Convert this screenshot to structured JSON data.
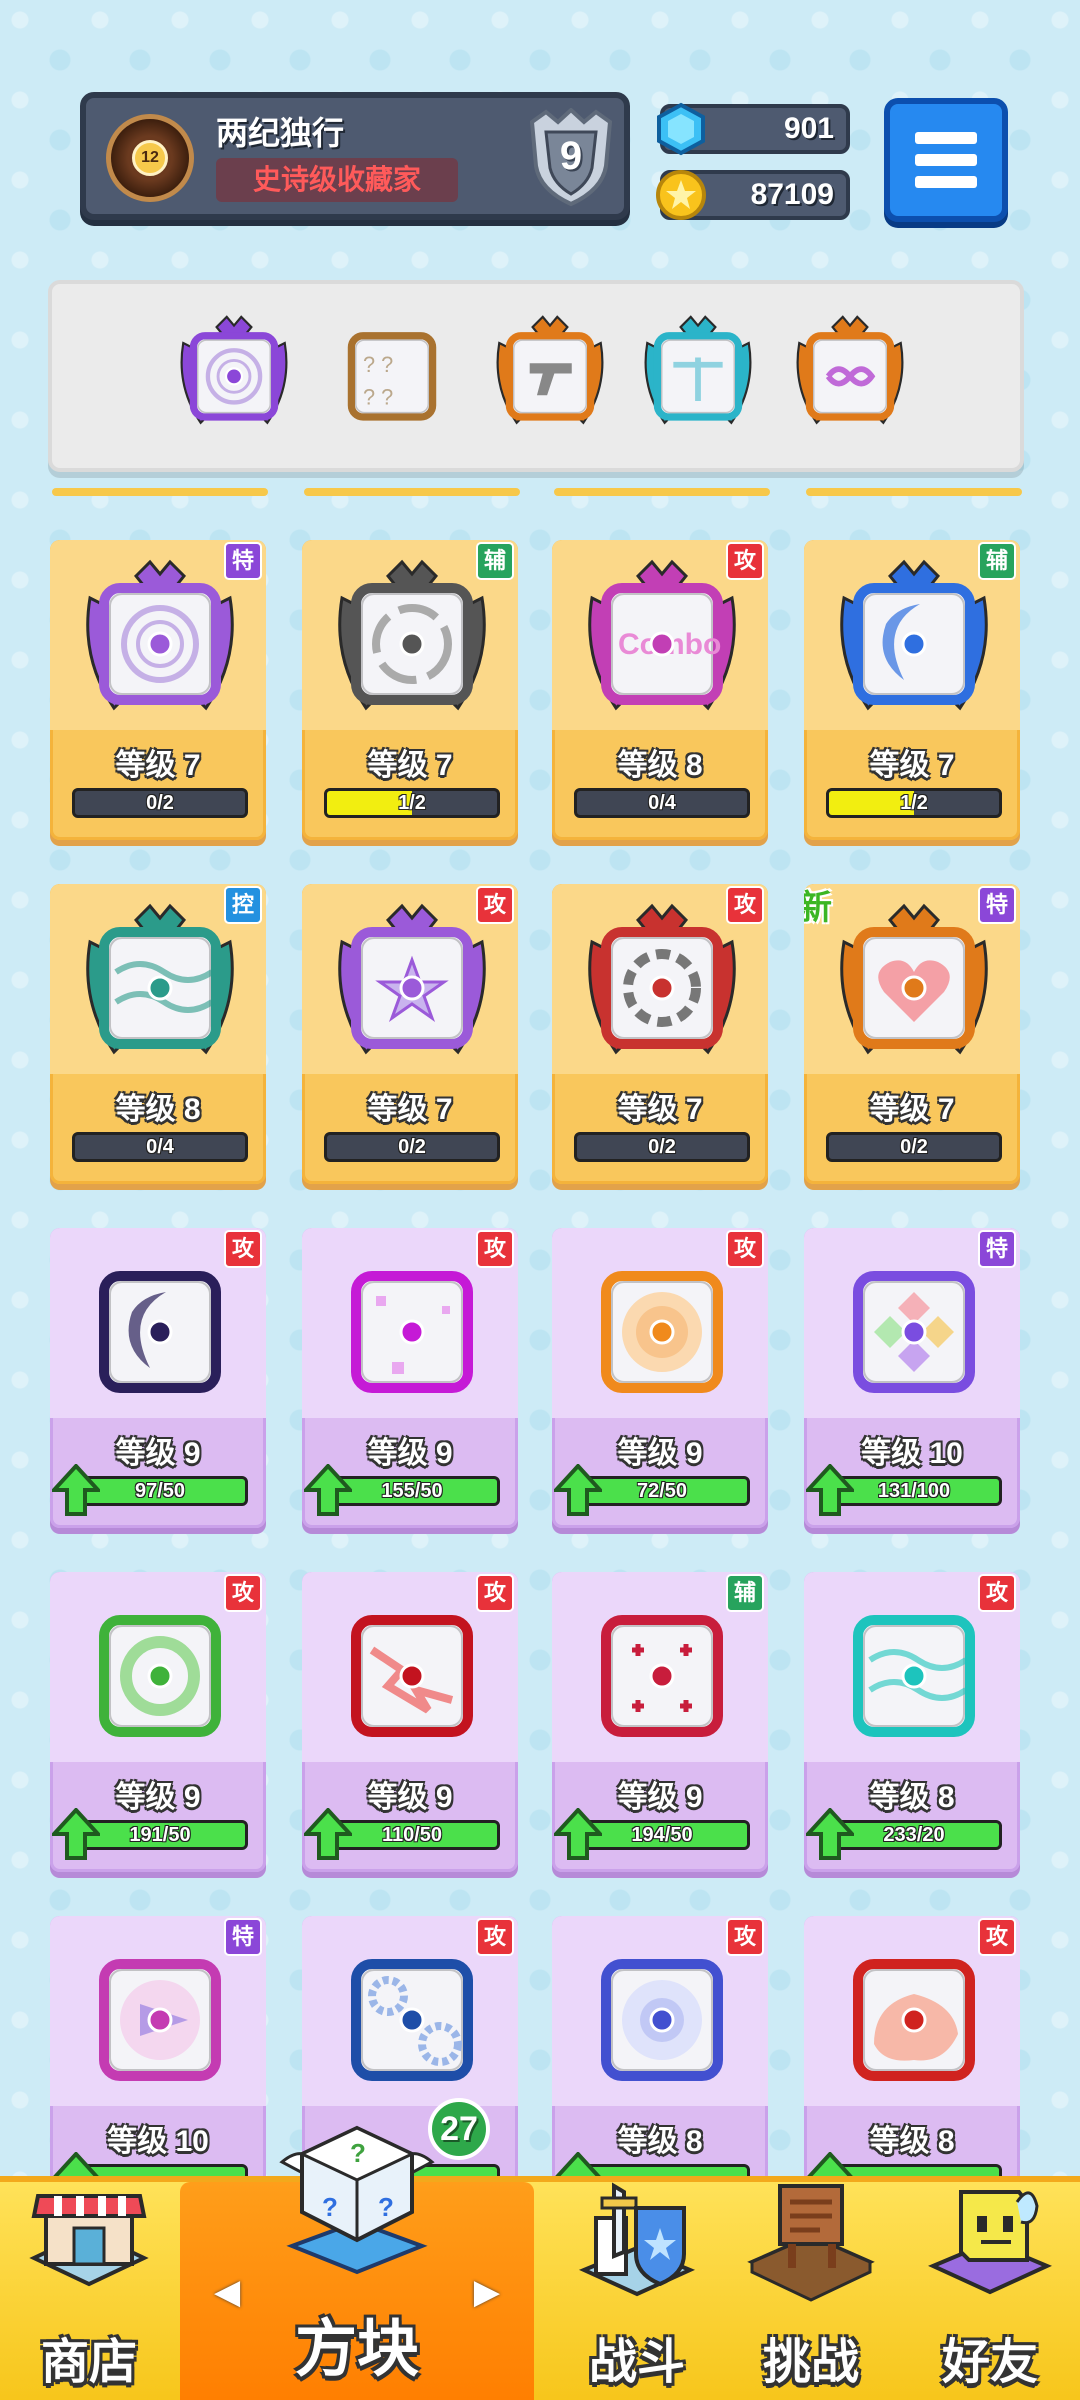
{
  "profile": {
    "name": "两纪独行",
    "title": "史诗级收藏家",
    "avatar_level": "12",
    "rank": "9"
  },
  "currency": {
    "gems": "901",
    "coins": "87109"
  },
  "deck": [
    {
      "icon": "purple-dragon-swirl-dice-icon",
      "accent": "#8b47d8"
    },
    {
      "icon": "question-mark-dice-icon",
      "accent": "#a9722f"
    },
    {
      "icon": "orange-dragon-gun-dice-icon",
      "accent": "#e07a1a"
    },
    {
      "icon": "teal-dragon-sword-dice-icon",
      "accent": "#2bb4c9"
    },
    {
      "icon": "orange-dragon-infinity-dice-icon",
      "accent": "#e07a1a"
    }
  ],
  "type_labels": {
    "attack": "攻",
    "support": "辅",
    "special": "特",
    "control": "控"
  },
  "cards": [
    {
      "rarity": "legendary",
      "icon": "purple-dragon-swirl-dice-icon",
      "accent": "#9b5ad9",
      "type": "特",
      "type_class": "t-spe",
      "level": "等级 7",
      "progress_text": "0/2",
      "progress": 0,
      "upgradable": false
    },
    {
      "rarity": "legendary",
      "icon": "grey-dragon-clock-dice-icon",
      "accent": "#555555",
      "type": "辅",
      "type_class": "t-sup",
      "level": "等级 7",
      "progress_text": "1/2",
      "progress": 0.5,
      "upgradable": false
    },
    {
      "rarity": "legendary",
      "icon": "pink-dragon-combo-dice-icon",
      "accent": "#c23fb5",
      "type": "攻",
      "type_class": "t-atk",
      "level": "等级 8",
      "progress_text": "0/4",
      "progress": 0,
      "upgradable": false
    },
    {
      "rarity": "legendary",
      "icon": "blue-dragon-moon-dice-icon",
      "accent": "#2f6fe0",
      "type": "辅",
      "type_class": "t-sup",
      "level": "等级 7",
      "progress_text": "1/2",
      "progress": 0.5,
      "upgradable": false
    },
    {
      "rarity": "legendary",
      "icon": "green-dragon-wave-dice-icon",
      "accent": "#2b9b8a",
      "type": "控",
      "type_class": "t-ctl",
      "level": "等级 8",
      "progress_text": "0/4",
      "progress": 0,
      "upgradable": false
    },
    {
      "rarity": "legendary",
      "icon": "purple-dragon-star-dice-icon",
      "accent": "#9b5ad9",
      "type": "攻",
      "type_class": "t-atk",
      "level": "等级 7",
      "progress_text": "0/2",
      "progress": 0,
      "upgradable": false
    },
    {
      "rarity": "legendary",
      "icon": "red-dragon-vortex-dice-icon",
      "accent": "#c8322f",
      "type": "攻",
      "type_class": "t-atk",
      "level": "等级 7",
      "progress_text": "0/2",
      "progress": 0,
      "upgradable": false
    },
    {
      "rarity": "legendary",
      "icon": "orange-dragon-heart-dice-icon",
      "accent": "#e07a1a",
      "type": "特",
      "type_class": "t-spe",
      "level": "等级 7",
      "progress_text": "0/2",
      "progress": 0,
      "upgradable": false,
      "new": "新"
    },
    {
      "rarity": "epic",
      "icon": "moon-cracks-dice-icon",
      "accent": "#2a1f5a",
      "type": "攻",
      "type_class": "t-atk",
      "level": "等级 9",
      "progress_text": "97/50",
      "progress": 1,
      "upgradable": true
    },
    {
      "rarity": "epic",
      "icon": "magenta-pixel-dice-icon",
      "accent": "#c51ad6",
      "type": "攻",
      "type_class": "t-atk",
      "level": "等级 9",
      "progress_text": "155/50",
      "progress": 1,
      "upgradable": true
    },
    {
      "rarity": "epic",
      "icon": "orange-target-dice-icon",
      "accent": "#f08a1c",
      "type": "攻",
      "type_class": "t-atk",
      "level": "等级 9",
      "progress_text": "72/50",
      "progress": 1,
      "upgradable": true
    },
    {
      "rarity": "epic",
      "icon": "rainbow-diamond-dice-icon",
      "accent": "#7a4de0",
      "type": "特",
      "type_class": "t-spe",
      "level": "等级 10",
      "progress_text": "131/100",
      "progress": 1,
      "upgradable": true
    },
    {
      "rarity": "epic",
      "icon": "green-biohazard-dice-icon",
      "accent": "#3fb23a",
      "type": "攻",
      "type_class": "t-atk",
      "level": "等级 9",
      "progress_text": "191/50",
      "progress": 1,
      "upgradable": true
    },
    {
      "rarity": "epic",
      "icon": "red-lightning-dice-icon",
      "accent": "#c3131f",
      "type": "攻",
      "type_class": "t-atk",
      "level": "等级 9",
      "progress_text": "110/50",
      "progress": 1,
      "upgradable": true
    },
    {
      "rarity": "epic",
      "icon": "red-cross-dice-icon",
      "accent": "#c81d3c",
      "type": "辅",
      "type_class": "t-sup",
      "level": "等级 9",
      "progress_text": "194/50",
      "progress": 1,
      "upgradable": true
    },
    {
      "rarity": "epic",
      "icon": "teal-wind-dice-icon",
      "accent": "#1dc4bd",
      "type": "攻",
      "type_class": "t-atk",
      "level": "等级 8",
      "progress_text": "233/20",
      "progress": 1,
      "upgradable": true
    },
    {
      "rarity": "epic",
      "icon": "purple-arrow-dice-icon",
      "accent": "#c43bb2",
      "type": "特",
      "type_class": "t-spe",
      "level": "等级 10",
      "progress_text": "",
      "progress": 1,
      "upgradable": true
    },
    {
      "rarity": "epic",
      "icon": "blue-gears-dice-icon",
      "accent": "#1e4ea8",
      "type": "攻",
      "type_class": "t-atk",
      "level": "",
      "progress_text": "",
      "progress": 1,
      "upgradable": true
    },
    {
      "rarity": "epic",
      "icon": "blue-eye-dice-icon",
      "accent": "#4250d0",
      "type": "攻",
      "type_class": "t-atk",
      "level": "等级 8",
      "progress_text": "",
      "progress": 1,
      "upgradable": true
    },
    {
      "rarity": "epic",
      "icon": "red-fire-dice-icon",
      "accent": "#d0231f",
      "type": "攻",
      "type_class": "t-atk",
      "level": "等级 8",
      "progress_text": "",
      "progress": 1,
      "upgradable": true
    }
  ],
  "nav": {
    "shop": "商店",
    "dice": "方块",
    "battle": "战斗",
    "challenge": "挑战",
    "friends": "好友",
    "dice_badge": "27",
    "prev_arrow": "◀",
    "next_arrow": "▶"
  }
}
